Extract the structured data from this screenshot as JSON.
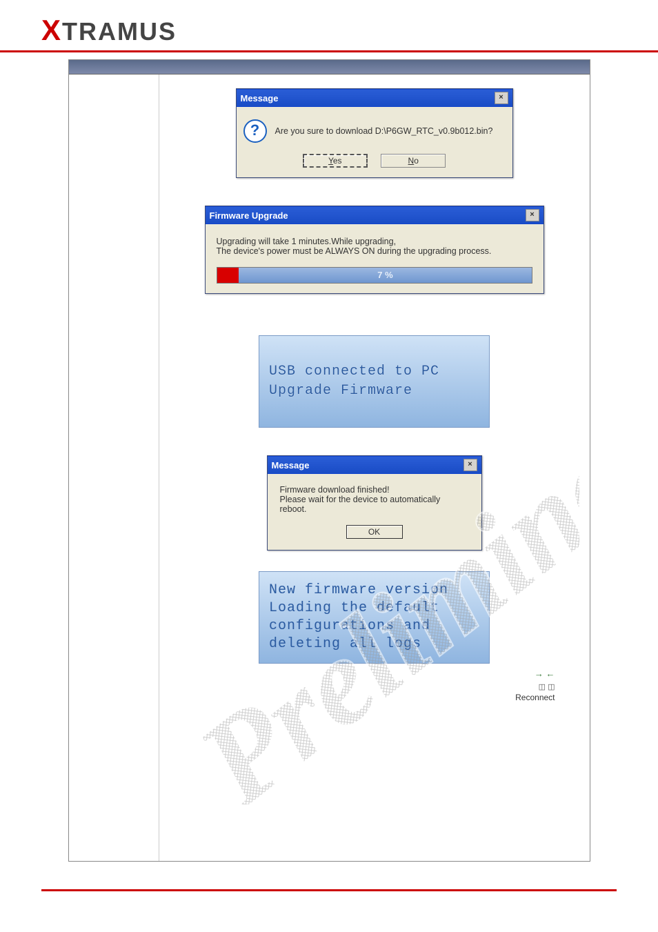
{
  "brand": {
    "x": "X",
    "rest": "TRAMUS"
  },
  "dialogs": {
    "confirm": {
      "title": "Message",
      "icon": "?",
      "text": "Are you sure to download D:\\P6GW_RTC_v0.9b012.bin?",
      "yes": "Yes",
      "no": "No"
    },
    "upgrade": {
      "title": "Firmware Upgrade",
      "line1": "Upgrading will take 1 minutes.While upgrading,",
      "line2": "The device's power must be ALWAYS ON during the upgrading process.",
      "progress_text": "7 %"
    },
    "lcd1": {
      "line1": "USB connected to PC",
      "line2": "Upgrade Firmware"
    },
    "finished": {
      "title": "Message",
      "line1": "Firmware download finished!",
      "line2": "Please wait for the device to automatically reboot.",
      "ok": "OK"
    },
    "lcd2": {
      "line1": "New firmware version",
      "line2": "Loading the default",
      "line3": "configurations and",
      "line4": "deleting all logs"
    },
    "reconnect": {
      "arrows": "↔",
      "plug": "⊞⊞",
      "label": "Reconnect"
    }
  },
  "watermark": "Preliminary"
}
